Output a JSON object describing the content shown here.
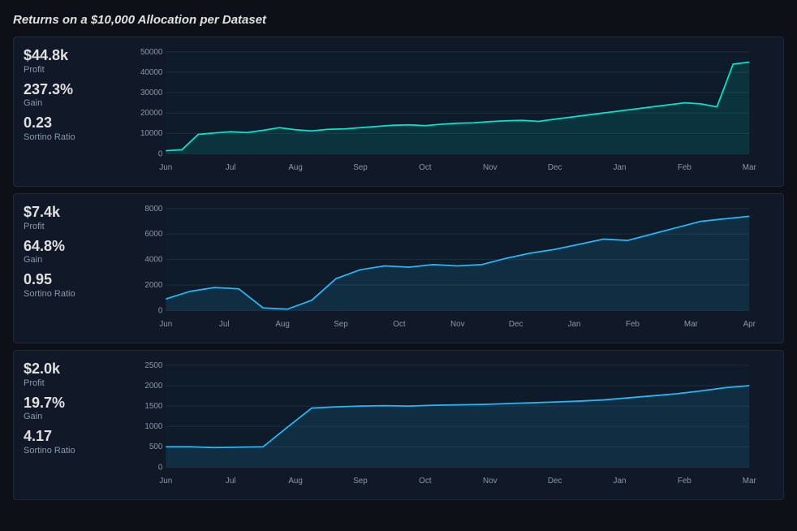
{
  "page": {
    "title": "Returns on a $10,000 Allocation per Dataset"
  },
  "charts": [
    {
      "id": "chart1",
      "stats": {
        "profit_value": "$44.8k",
        "profit_label": "Profit",
        "gain_value": "237.3%",
        "gain_label": "Gain",
        "sortino_value": "0.23",
        "sortino_label": "Sortino Ratio"
      },
      "y_labels": [
        "50000",
        "40000",
        "30000",
        "20000",
        "10000",
        "0"
      ],
      "x_labels": [
        "Jun",
        "Jul",
        "Aug",
        "Sep",
        "Oct",
        "Nov",
        "Dec",
        "Jan",
        "Feb",
        "Mar"
      ],
      "color": "#00e5cc",
      "max_y": 50000,
      "data_points": [
        1500,
        2000,
        9500,
        10200,
        10800,
        10400,
        11500,
        12800,
        11800,
        11200,
        12000,
        12200,
        12800,
        13400,
        14000,
        14200,
        13800,
        14500,
        15000,
        15200,
        15800,
        16200,
        16400,
        15900,
        17000,
        18000,
        19000,
        20000,
        21000,
        22000,
        23000,
        24000,
        25000,
        24500,
        23000,
        44000,
        45000
      ]
    },
    {
      "id": "chart2",
      "stats": {
        "profit_value": "$7.4k",
        "profit_label": "Profit",
        "gain_value": "64.8%",
        "gain_label": "Gain",
        "sortino_value": "0.95",
        "sortino_label": "Sortino Ratio"
      },
      "y_labels": [
        "8000",
        "6000",
        "4000",
        "2000",
        "0"
      ],
      "x_labels": [
        "Jun",
        "Jul",
        "Aug",
        "Sep",
        "Oct",
        "Nov",
        "Dec",
        "Jan",
        "Feb",
        "Mar",
        "Apr"
      ],
      "color": "#29b6f6",
      "max_y": 8000,
      "data_points": [
        900,
        1500,
        1800,
        1700,
        200,
        100,
        800,
        2500,
        3200,
        3500,
        3400,
        3600,
        3500,
        3600,
        4100,
        4500,
        4800,
        5200,
        5600,
        5500,
        6000,
        6500,
        7000,
        7200,
        7400
      ]
    },
    {
      "id": "chart3",
      "stats": {
        "profit_value": "$2.0k",
        "profit_label": "Profit",
        "gain_value": "19.7%",
        "gain_label": "Gain",
        "sortino_value": "4.17",
        "sortino_label": "Sortino Ratio"
      },
      "y_labels": [
        "2500",
        "2000",
        "1500",
        "1000",
        "500",
        "0"
      ],
      "x_labels": [
        "Jun",
        "Jul",
        "Aug",
        "Sep",
        "Oct",
        "Nov",
        "Dec",
        "Jan",
        "Feb",
        "Mar"
      ],
      "color": "#29b6f6",
      "max_y": 2500,
      "data_points": [
        500,
        500,
        480,
        490,
        500,
        980,
        1450,
        1480,
        1500,
        1510,
        1500,
        1520,
        1530,
        1540,
        1560,
        1580,
        1600,
        1620,
        1650,
        1700,
        1750,
        1800,
        1870,
        1950,
        2000
      ]
    }
  ]
}
